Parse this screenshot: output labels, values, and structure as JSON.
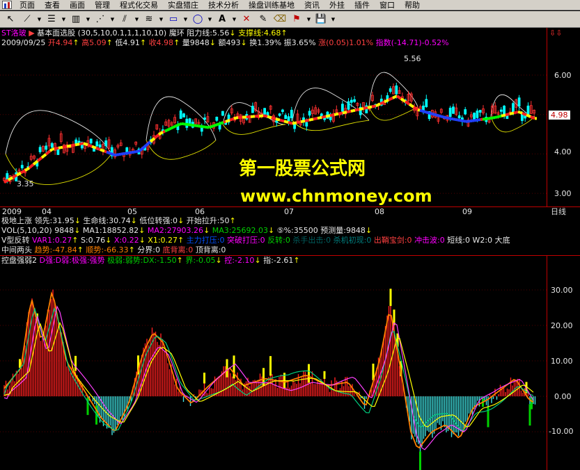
{
  "menubar": {
    "items": [
      "页面",
      "查看",
      "画面",
      "管理",
      "程式化交易",
      "实盘猎庄",
      "技术分析",
      "操盘训练基地",
      "资讯",
      "外挂",
      "插件",
      "窗口",
      "帮助"
    ]
  },
  "toolbar": {
    "buttons": [
      "cursor-icon",
      "trendline-icon",
      "parallel-icon",
      "bars-icon",
      "fan-icon",
      "channel-icon",
      "wave-icon",
      "rectangle-icon",
      "ellipse-icon",
      "text-icon",
      "delete-icon",
      "pen-icon",
      "eraser-icon",
      "flag-icon",
      "save-icon"
    ]
  },
  "main_header": {
    "stock_name": "ST洛玻",
    "arrow": "▶",
    "formula": "基本面选股 (30,5,10,0.1,1,1,10,10)",
    "extra1": "魔环",
    "resist": "阻力线:5.56",
    "support": "支撑线:4.68",
    "up_arrow": "↑",
    "down_arrow": "↓",
    "top_right_icon": "⇩⇩",
    "date": "2009/09/25",
    "open": "开4.94",
    "high": "高5.09",
    "low": "低4.91",
    "close": "收4.98",
    "volume": "量9848",
    "amount": "额493",
    "turnover": "换1.39%",
    "amplitude": "振3.65%",
    "change": "涨(0.05)1.01%",
    "index": "指数(-14.71)-0.52%"
  },
  "price_chart": {
    "price_labels": [
      "6.00",
      "5.00",
      "4.00",
      "3.00"
    ],
    "current_price": "4.98",
    "high_label": "5.56",
    "low_label": "3.35",
    "date_labels": [
      "2009",
      "04",
      "05",
      "06",
      "07",
      "08",
      "09"
    ],
    "period": "日线",
    "colors": {
      "up": "#ff3030",
      "down": "#00ffff",
      "ma_up_red": "#ff2020",
      "ma_up_yellow": "#ffff00",
      "ma_down_blue": "#2040ff",
      "ma_green": "#00ff00",
      "band": "#e8e8e8",
      "band_low": "#e0e000"
    }
  },
  "indicator_lines": {
    "line1": {
      "name": "极地上涨",
      "a": "领先:31.95",
      "b": "生命线:30.74",
      "c": "低位转强:0",
      "d": "开始拉升:50"
    },
    "line2": {
      "name": "VOL(5,10,20)",
      "a": "9848",
      "b": "MA1:18852.82",
      "c": "MA2:27903.26",
      "d": "MA3:25692.03",
      "e": "⑤%:35500",
      "f": "预测量:9848"
    },
    "line3": {
      "name": "V型反转",
      "a": "VAR1:0.27",
      "b": "S:0.76",
      "c": "X:0.22",
      "d": "X1:0.27",
      "e": "主力打压:0",
      "f": "突破打压:0",
      "g": "反转:0",
      "h": "杀手出击:0",
      "i": "杀机初现:0",
      "j": "出鞘宝剑:0",
      "k": "冲击波:0",
      "l": "短线:0",
      "m": "W2:0",
      "n": "大底"
    },
    "line4": {
      "name": "中间两头",
      "a": "趋势:-47.84",
      "b": "顺势:-66.33",
      "c": "分界:0",
      "d": "底背离:0",
      "e": "顶背离:0"
    },
    "line5": {
      "name": "控盘强弱2",
      "a": "D强:D弱:极强:强势",
      "b": "极弱:弱势:DX:-1.50",
      "c": "界:-0.05",
      "d": "控:-2.10",
      "e": "指:-2.61"
    }
  },
  "osc_chart": {
    "labels": [
      "30.00",
      "20.00",
      "10.00",
      "0.00",
      "-10.00"
    ]
  },
  "watermark": {
    "title": "第一股票公式网",
    "url": "www.chnmoney.com"
  }
}
